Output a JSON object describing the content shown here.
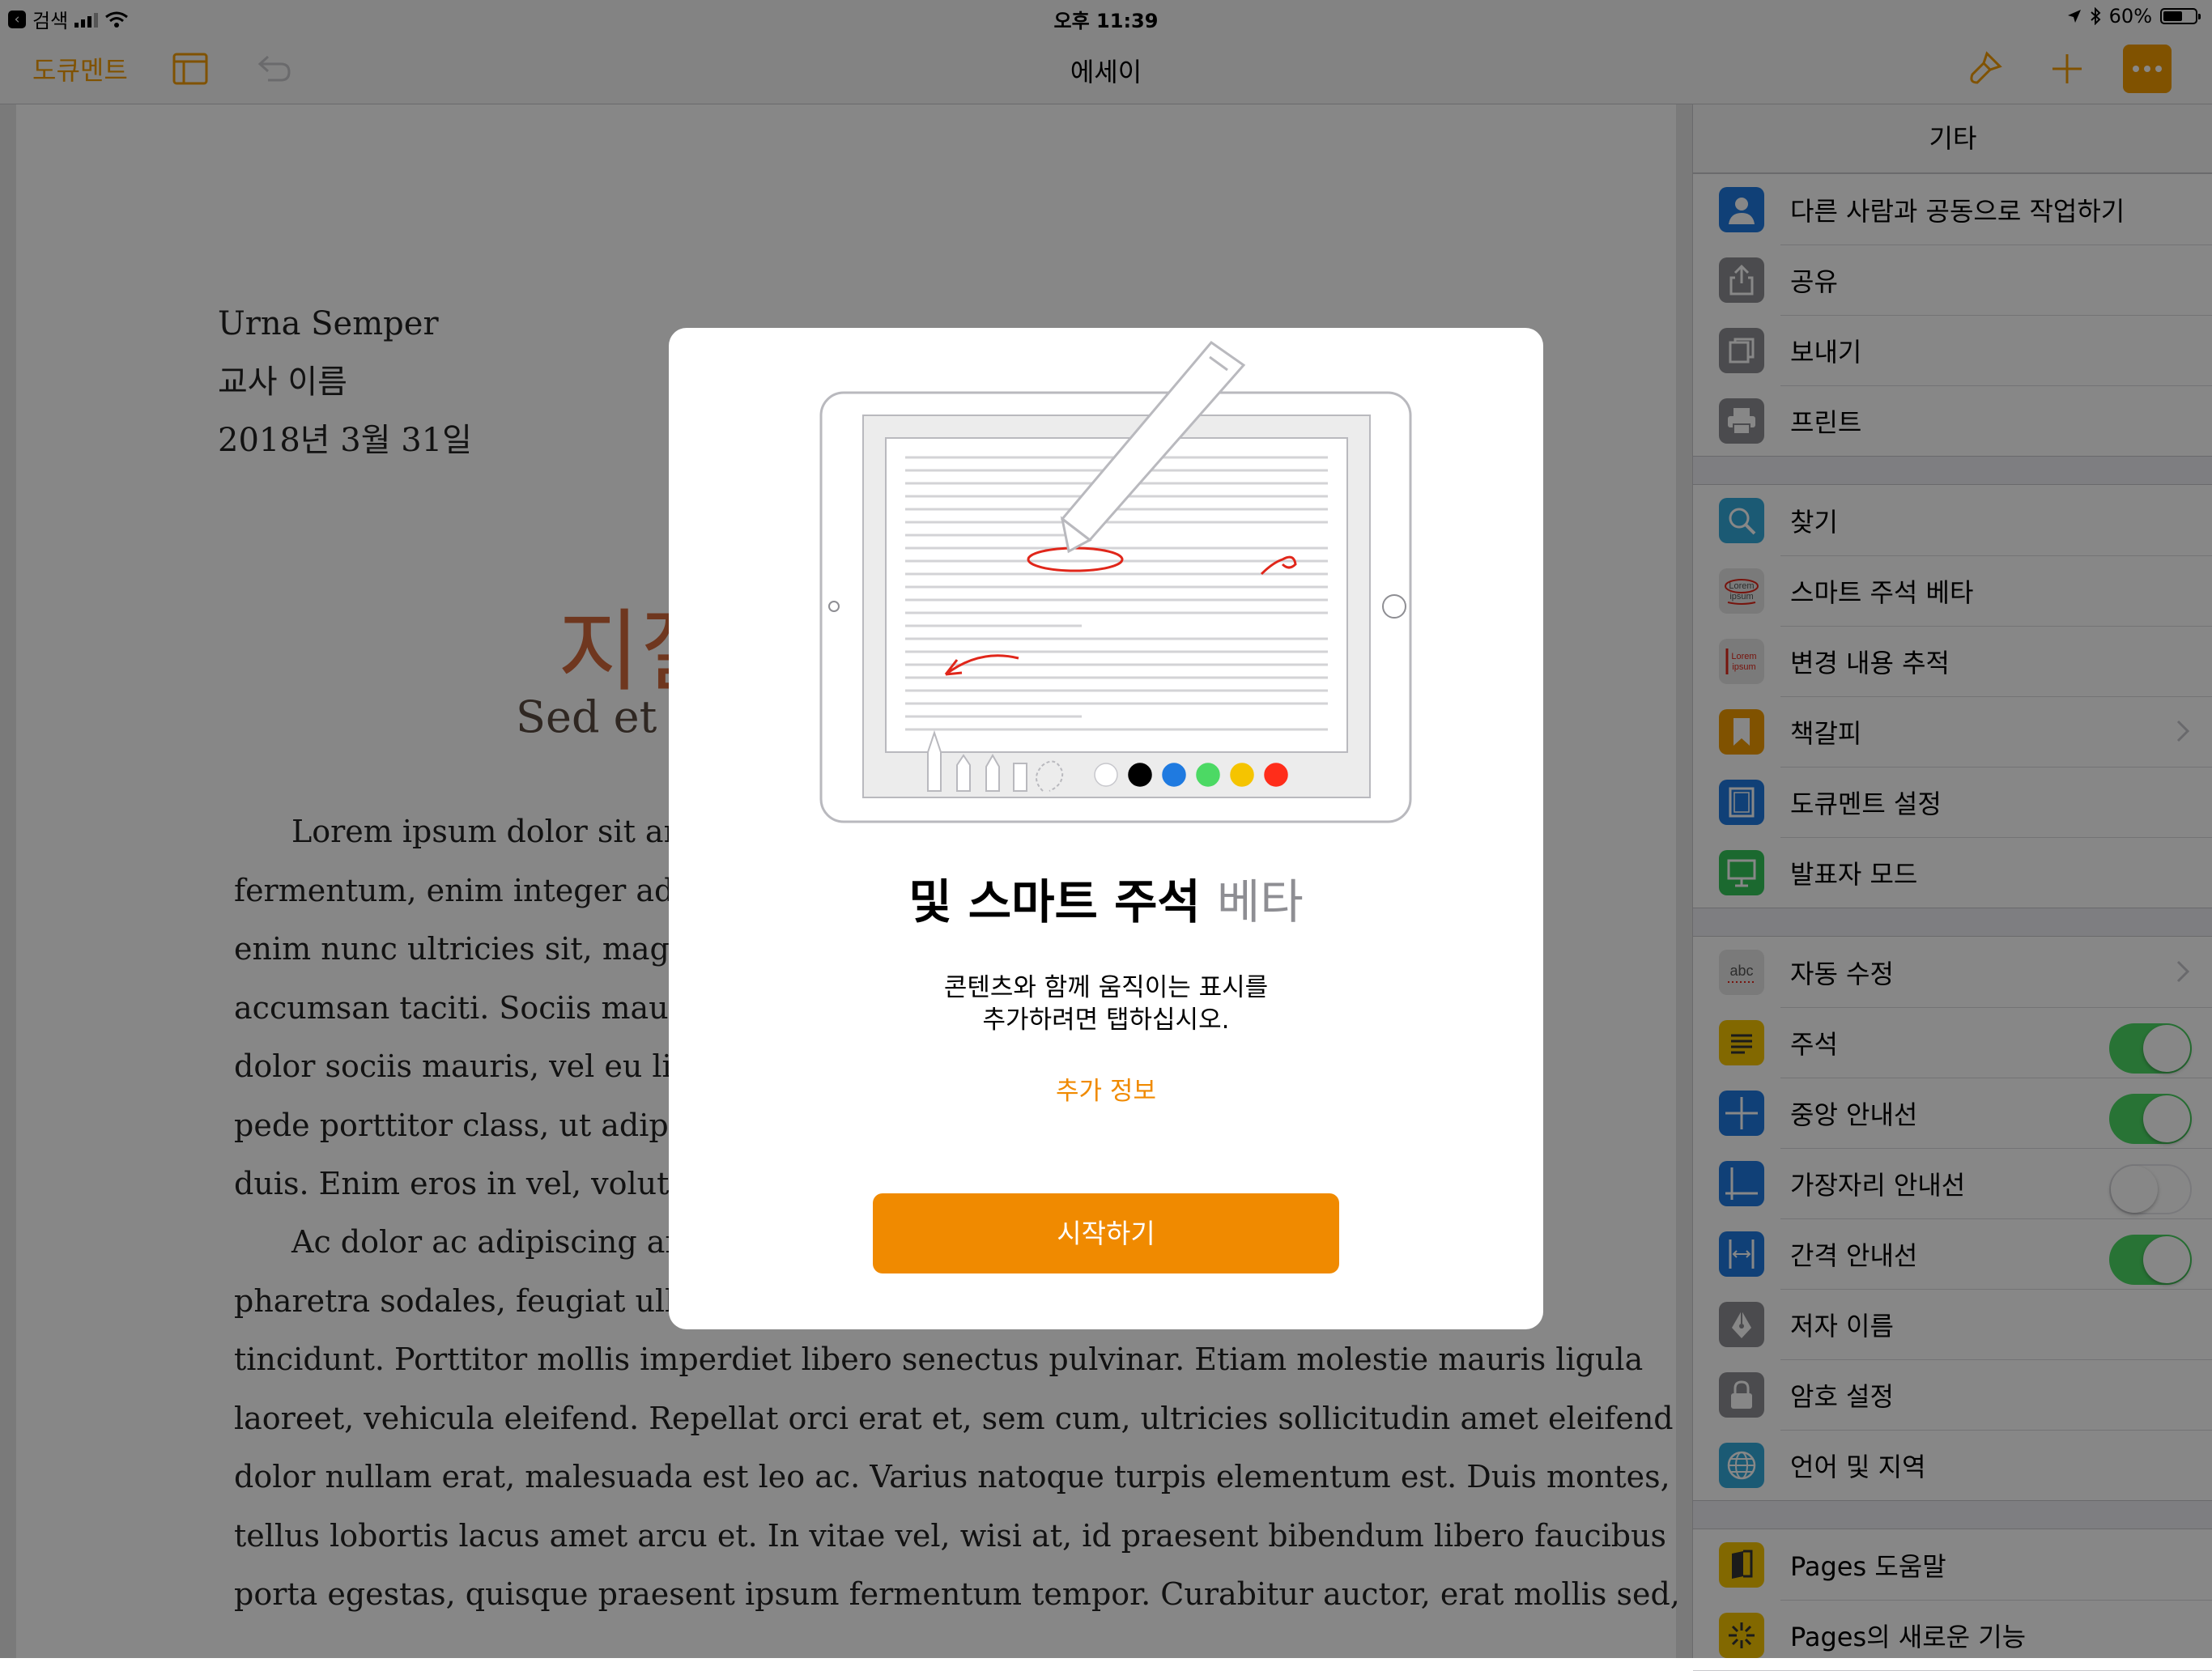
{
  "status_bar": {
    "back_app": "검색",
    "time": "오후 11:39",
    "battery": "60%",
    "battery_level": 0.6
  },
  "toolbar": {
    "documents": "도큐멘트",
    "title": "에세이"
  },
  "document": {
    "author": "Urna Semper",
    "teacher": "교사 이름",
    "date": "2018년 3월 31일",
    "title": "지질",
    "subtitle": "Sed et lacu",
    "body_lines": [
      "Lorem ipsum dolor sit amet.",
      "fermentum, enim integer ad vestib",
      "enim nunc ultricies sit, magna tinc",
      "accumsan taciti. Sociis mauris in in",
      "dolor sociis mauris, vel eu libero c",
      "pede porttitor class, ut adipiscing,",
      "duis. Enim eros in vel, volutpat ne",
      "Ac dolor ac adipiscing amet",
      "pharetra sodales, feugiat ullamcorp",
      "tincidunt. Porttitor mollis imperdiet libero senectus pulvinar. Etiam molestie mauris ligula",
      "laoreet, vehicula eleifend. Repellat orci erat et, sem cum, ultricies sollicitudin amet eleifend",
      "dolor nullam erat, malesuada est leo ac. Varius natoque turpis elementum est. Duis montes,",
      "tellus lobortis lacus amet arcu et. In vitae vel, wisi at, id praesent bibendum libero faucibus",
      "porta egestas, quisque praesent ipsum fermentum tempor. Curabitur auctor, erat mollis sed,"
    ]
  },
  "sidebar": {
    "header": "기타",
    "groups": [
      [
        {
          "label": "다른 사람과 공동으로 작업하기",
          "icon": "collaborate-icon",
          "color": "#1f7ae0"
        },
        {
          "label": "공유",
          "icon": "share-icon",
          "color": "#8e8e93"
        },
        {
          "label": "보내기",
          "icon": "export-icon",
          "color": "#8e8e93"
        },
        {
          "label": "프린트",
          "icon": "print-icon",
          "color": "#8e8e93"
        }
      ],
      [
        {
          "label": "찾기",
          "icon": "search-icon",
          "color": "#34aadc"
        },
        {
          "label": "스마트 주석 베타",
          "icon": "smart-annotation-icon",
          "color": "#e6e6e6",
          "icon_text": "Lorem ipsum"
        },
        {
          "label": "변경 내용 추적",
          "icon": "track-changes-icon",
          "color": "#e6e6e6",
          "icon_text": "Lorem ipsum"
        },
        {
          "label": "책갈피",
          "icon": "bookmark-icon",
          "color": "#f29b00",
          "chevron": true
        },
        {
          "label": "도큐멘트 설정",
          "icon": "document-setup-icon",
          "color": "#1f7ae0"
        },
        {
          "label": "발표자 모드",
          "icon": "presenter-mode-icon",
          "color": "#34c759"
        }
      ],
      [
        {
          "label": "자동 수정",
          "icon": "auto-correct-icon",
          "color": "#e6e6e6",
          "icon_text": "abc",
          "chevron": true
        },
        {
          "label": "주석",
          "icon": "comments-icon",
          "color": "#f5c400",
          "toggle": true
        },
        {
          "label": "중앙 안내선",
          "icon": "center-guides-icon",
          "color": "#1f7ae0",
          "toggle": true
        },
        {
          "label": "가장자리 안내선",
          "icon": "edge-guides-icon",
          "color": "#1f7ae0",
          "toggle": false
        },
        {
          "label": "간격 안내선",
          "icon": "spacing-guides-icon",
          "color": "#1f7ae0",
          "toggle": true
        },
        {
          "label": "저자 이름",
          "icon": "author-pen-icon",
          "color": "#8e8e93"
        },
        {
          "label": "암호 설정",
          "icon": "lock-icon",
          "color": "#8e8e93"
        },
        {
          "label": "언어 및 지역",
          "icon": "globe-icon",
          "color": "#34aadc"
        }
      ],
      [
        {
          "label": "Pages 도움말",
          "icon": "help-book-icon",
          "color": "#f5c400"
        },
        {
          "label": "Pages의 새로운 기능",
          "icon": "whats-new-icon",
          "color": "#f5c400"
        }
      ]
    ]
  },
  "modal": {
    "heading": "및 스마트 주석",
    "heading_beta": "베타",
    "description_line1": "콘텐츠와 함께 움직이는 표시를",
    "description_line2": "추가하려면 탭하십시오.",
    "more_info": "추가 정보",
    "start_button": "시작하기",
    "palette_colors": [
      "#ffffff",
      "#000000",
      "#1f7ae0",
      "#4cd964",
      "#f5c400",
      "#ff2d1a"
    ]
  },
  "colors": {
    "accent": "#f08a00",
    "annotation_red": "#e0261a"
  }
}
